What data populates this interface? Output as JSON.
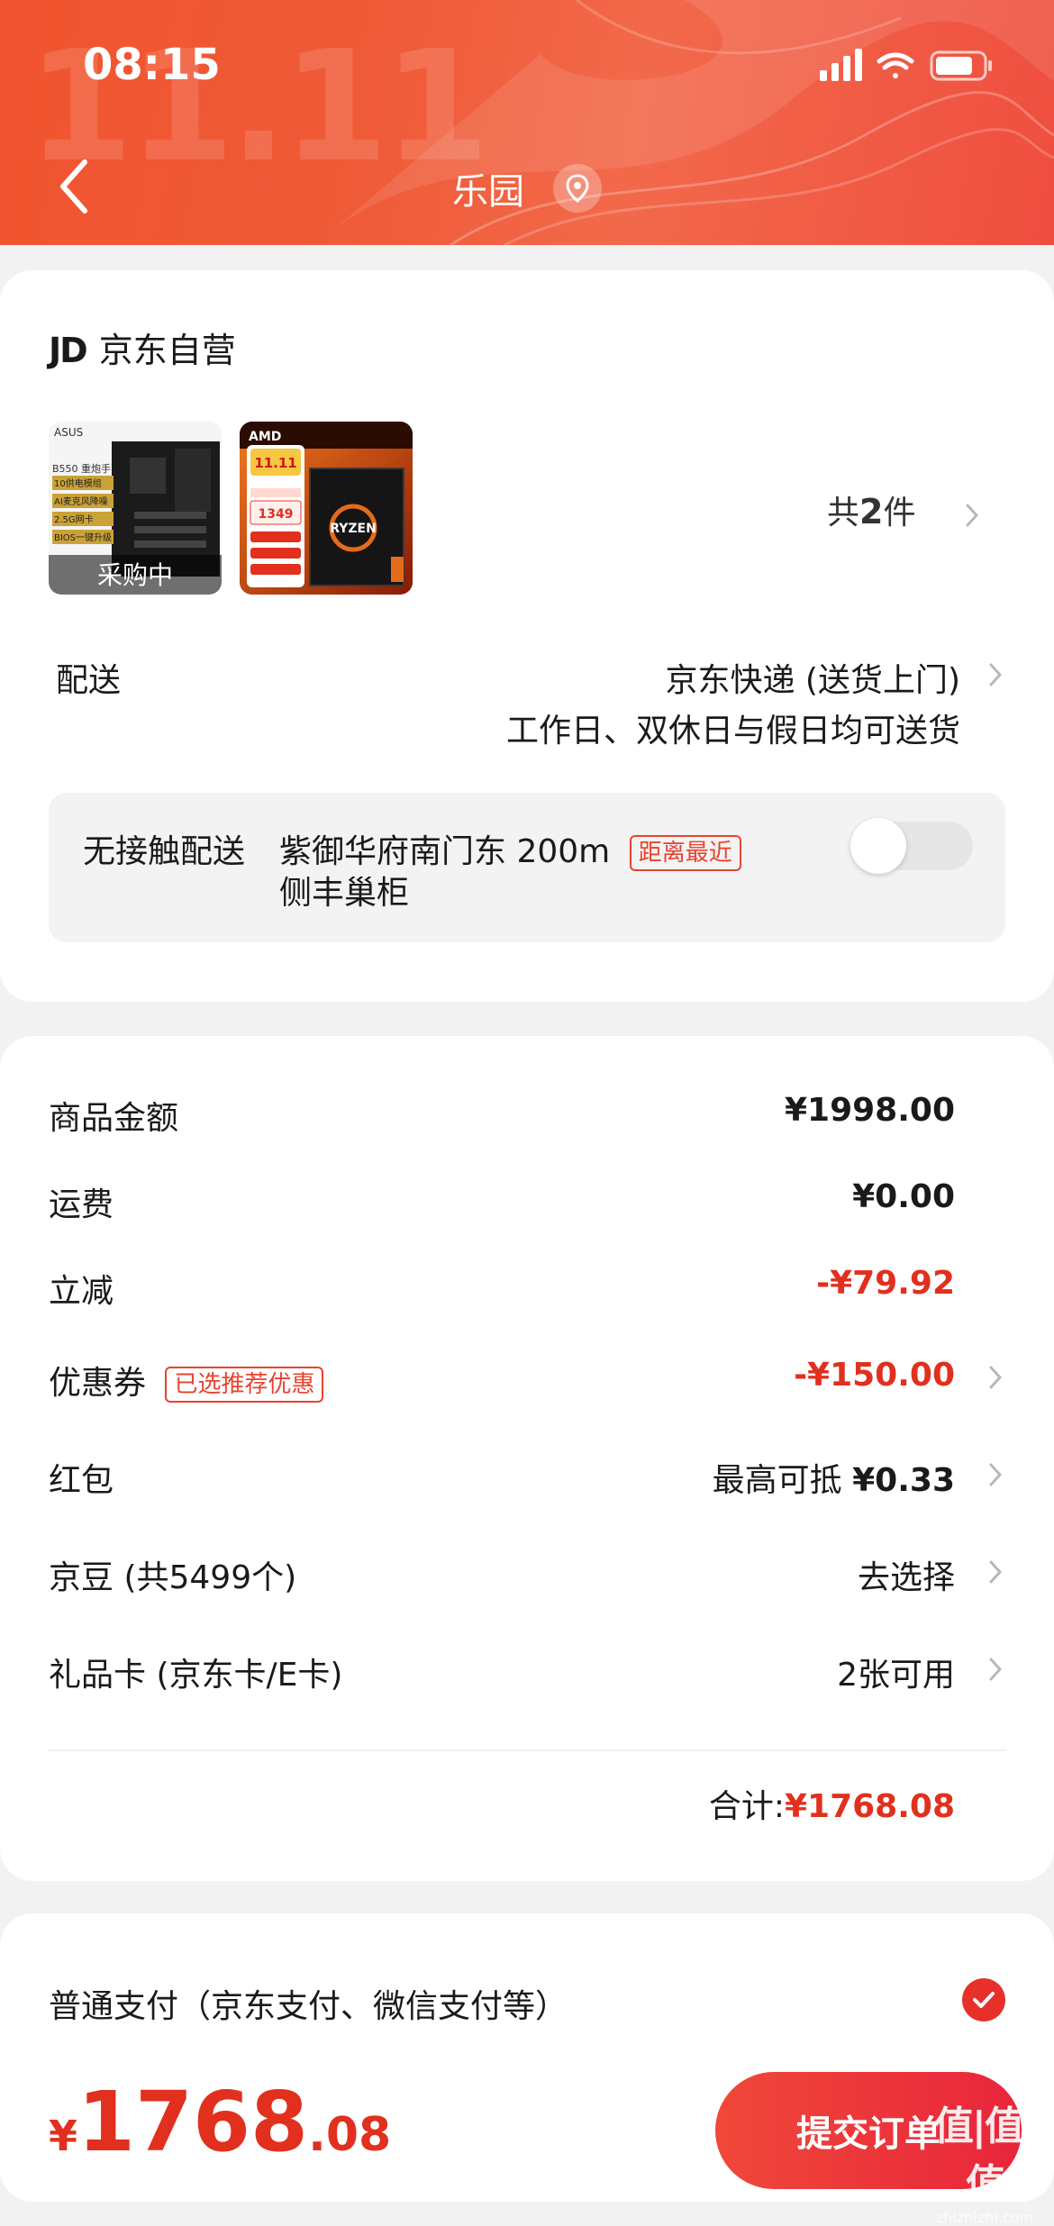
{
  "status_bar": {
    "time": "08:15"
  },
  "header": {
    "title": "乐园",
    "bg_color": "#ef5a37",
    "ghost_text": "11.11"
  },
  "store": {
    "logo": "JD",
    "name": "京东自营",
    "items": [
      {
        "image_caption": "采购中",
        "brand": "ASUS",
        "lines": [
          "B550 重炮手",
          "10供电模组",
          "AI麦克风降噪",
          "2.5G网卡",
          "BIOS一键升级"
        ]
      },
      {
        "brand": "AMD",
        "lines": [
          "11.11",
          "1349"
        ],
        "cpu_label": "RYZEN"
      }
    ],
    "count_prefix": "共",
    "count_number": "2",
    "count_suffix": "件"
  },
  "delivery": {
    "label": "配送",
    "method": "京东快递 (送货上门)",
    "note": "工作日、双休日与假日均可送货"
  },
  "contactless": {
    "label": "无接触配送",
    "address_line1": "紫御华府南门东 200m",
    "badge": "距离最近",
    "address_line2": "侧丰巢柜",
    "enabled": false
  },
  "summary": {
    "rows": [
      {
        "label": "商品金额",
        "value": "¥1998.00"
      },
      {
        "label": "运费",
        "value": "¥0.00"
      },
      {
        "label": "立减",
        "value": "-¥79.92"
      },
      {
        "label": "优惠券",
        "tag": "已选推荐优惠",
        "value": "-¥150.00"
      },
      {
        "label": "红包",
        "value_prefix": "最高可抵 ",
        "value": "¥0.33"
      },
      {
        "label": "京豆 (共5499个)",
        "value": "去选择"
      },
      {
        "label": "礼品卡 (京东卡/E卡)",
        "value": "2张可用"
      }
    ],
    "total_label": "合计:",
    "total_value": "¥1768.08"
  },
  "payment": {
    "label": "普通支付（京东支付、微信支付等）",
    "selected": true
  },
  "footer": {
    "currency": "¥",
    "total_int": "1768",
    "total_dec": ".08",
    "submit_label": "提交订单",
    "watermark_main": "值|值|值",
    "watermark_sub": "zhizhizhi.com"
  },
  "colors": {
    "accent": "#e1301e",
    "header": "#ef5a37"
  }
}
